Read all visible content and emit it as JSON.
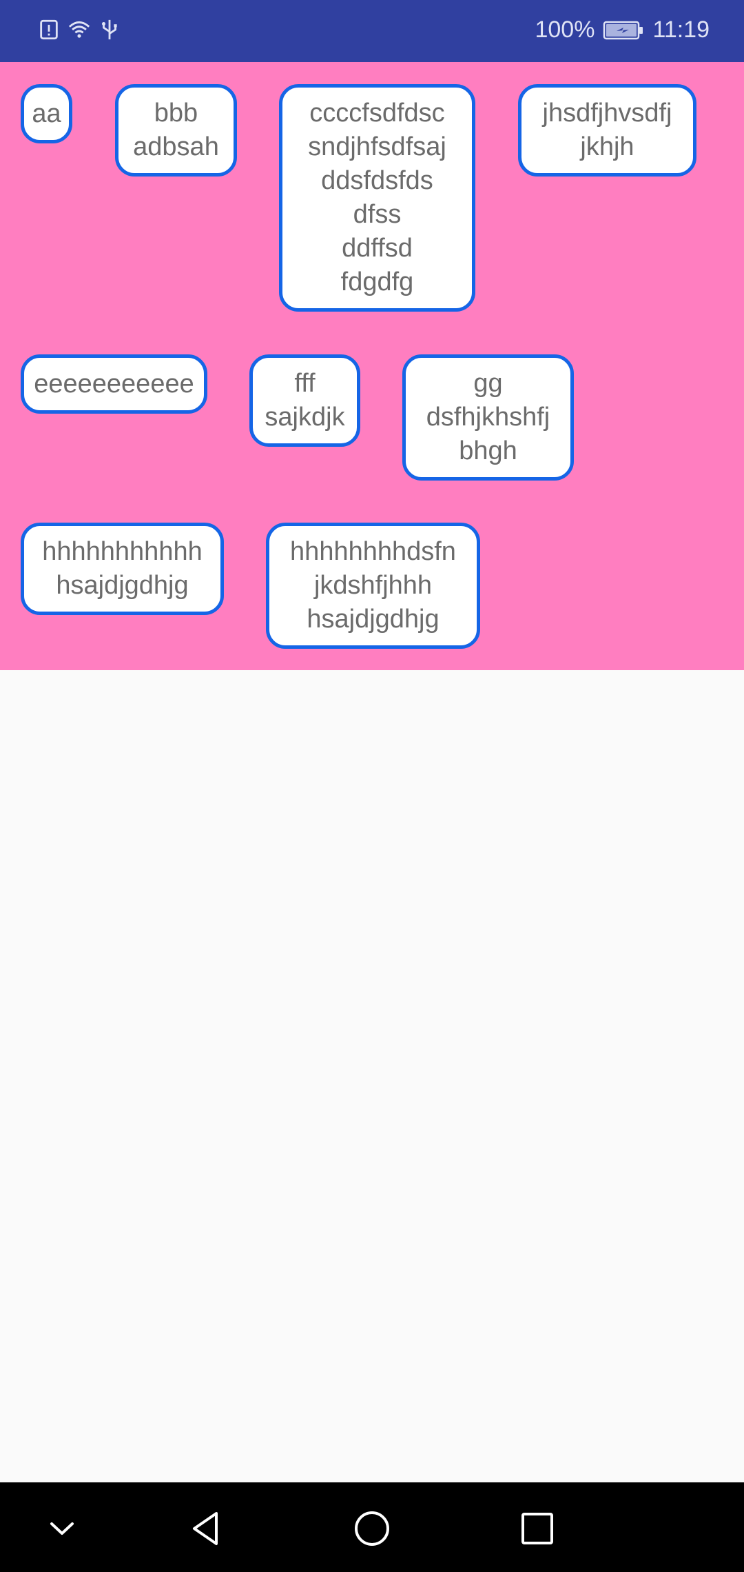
{
  "status_bar": {
    "battery_percent": "100%",
    "time": "11:19",
    "icons": [
      "alert-icon",
      "wifi-icon",
      "usb-icon",
      "battery-icon"
    ]
  },
  "tags": [
    "aa",
    "bbb\nadbsah",
    "ccccfsdfdsc\nsndjhfsdfsaj\nddsfdsfds\ndfss\nddffsd\nfdgdfg",
    "jhsdfjhvsdfj\njkhjh",
    "eeeeeeeeeee",
    "fff\nsajkdjk",
    "gg\ndsfhjkhshfj\nbhgh",
    "hhhhhhhhhhh\nhsajdjgdhjg",
    "hhhhhhhhdsfn\njkdshfjhhh\nhsajdjgdhjg"
  ],
  "nav_bar": {
    "buttons": [
      "chevron-down-icon",
      "back-icon",
      "home-icon",
      "recents-icon"
    ]
  },
  "colors": {
    "status_bar": "#3040a0",
    "tag_area": "#ff7ec0",
    "tag_border": "#1565e6",
    "tag_text": "#6b6b6b"
  }
}
